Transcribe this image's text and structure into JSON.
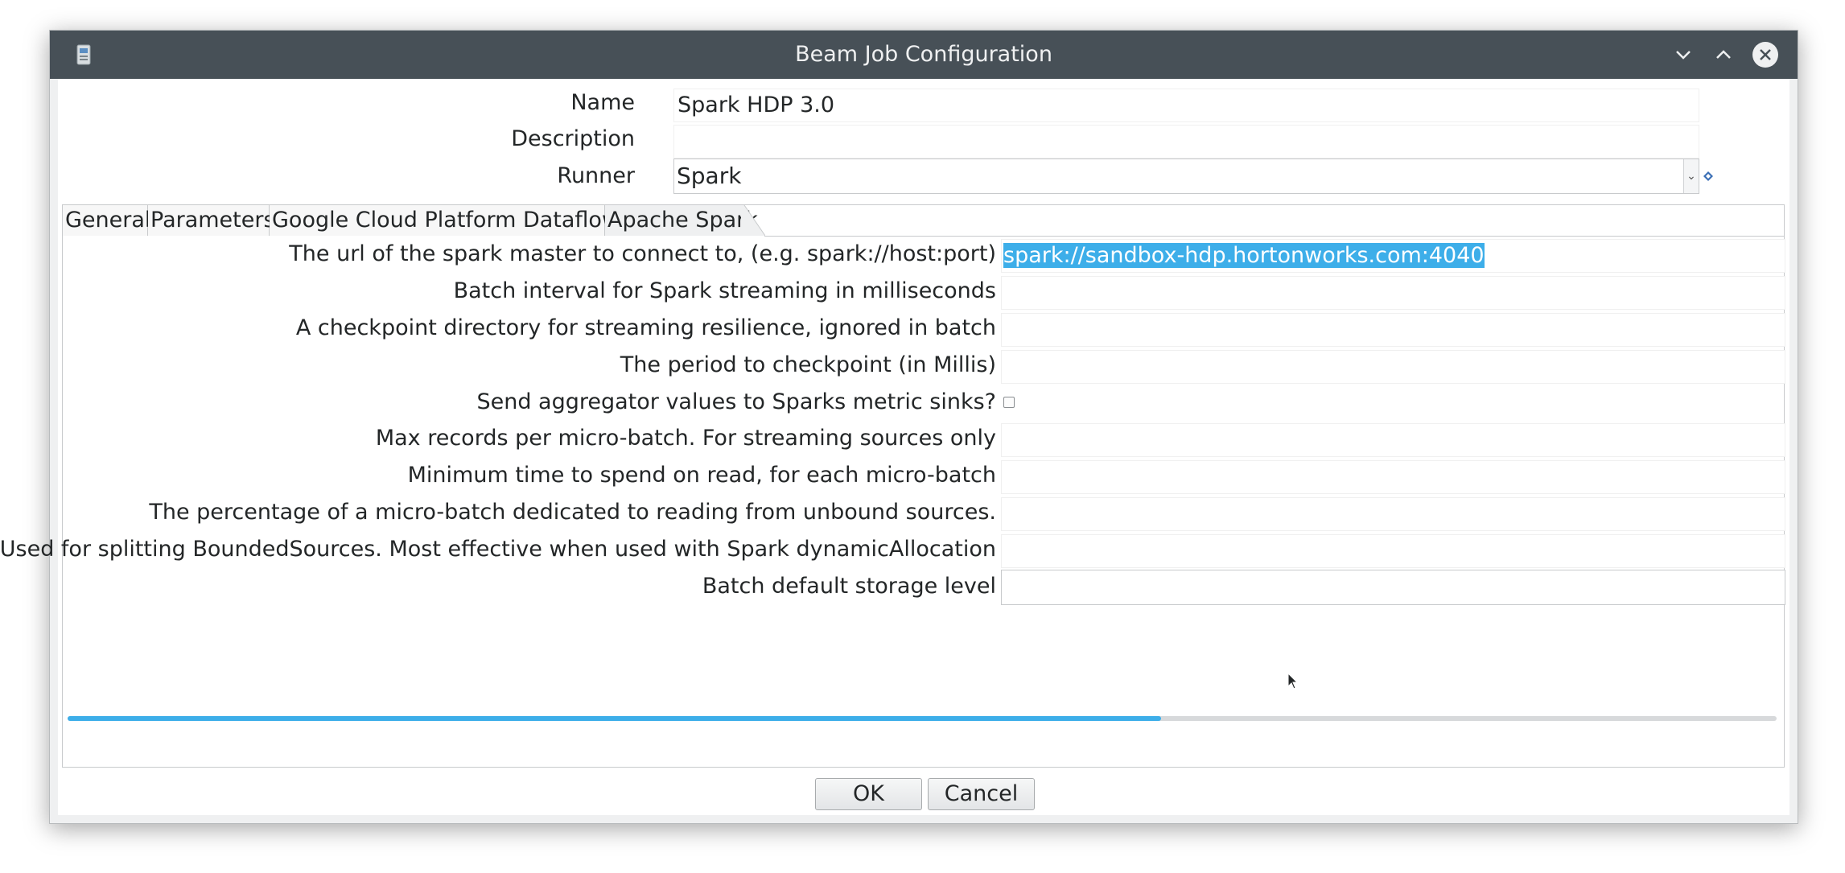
{
  "window": {
    "title": "Beam Job Configuration"
  },
  "form": {
    "name_label": "Name",
    "name_value": "Spark HDP 3.0",
    "description_label": "Description",
    "description_value": "",
    "runner_label": "Runner",
    "runner_value": "Spark"
  },
  "tabs": [
    {
      "label": "General",
      "active": false
    },
    {
      "label": "Parameters",
      "active": false
    },
    {
      "label": "Google Cloud Platform Dataflow",
      "active": false
    },
    {
      "label": "Apache Spark",
      "active": true
    }
  ],
  "spark": {
    "master_label": "The url of the spark master to connect to, (e.g. spark://host:port)",
    "master_value": "spark://sandbox-hdp.hortonworks.com:4040",
    "batch_interval_label": "Batch interval for Spark streaming in milliseconds",
    "checkpoint_dir_label": "A checkpoint directory for streaming resilience, ignored in batch",
    "checkpoint_period_label": "The period to checkpoint (in Millis)",
    "metric_sinks_label": "Send aggregator values to Sparks metric sinks?",
    "metric_sinks_checked": false,
    "max_records_label": "Max records per micro-batch. For streaming sources only",
    "min_read_time_label": "Minimum time to spend on read, for each micro-batch",
    "read_time_pct_label": "The percentage of a micro-batch dedicated to reading from unbound sources.",
    "bundle_size_label": "Used for splitting BoundedSources. Most effective when used with Spark dynamicAllocation",
    "storage_level_label": "Batch default storage level"
  },
  "horizontal_scroll_fraction": 0.64,
  "buttons": {
    "ok": "OK",
    "cancel": "Cancel"
  },
  "colors": {
    "titlebar": "#475057",
    "selection": "#3daee9"
  }
}
